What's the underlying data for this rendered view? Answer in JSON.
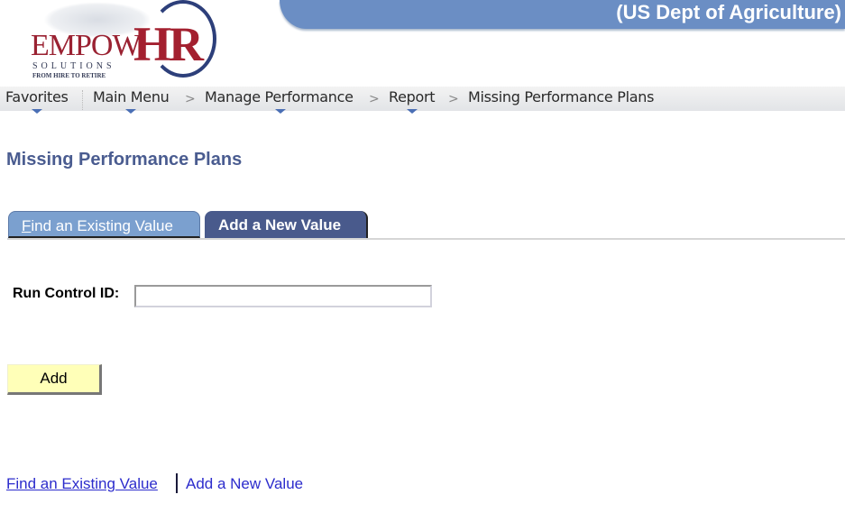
{
  "header": {
    "logo": {
      "brand_main": "EMPOW",
      "brand_accent": "HR",
      "subtitle": "SOLUTIONS",
      "tagline": "FROM HIRE TO RETIRE"
    },
    "organization": "(US Dept of Agriculture)"
  },
  "navbar": {
    "items": [
      {
        "label": "Favorites",
        "has_menu": true
      },
      {
        "label": "Main Menu",
        "has_menu": true
      },
      {
        "label": "Manage Performance",
        "has_menu": true
      },
      {
        "label": "Report",
        "has_menu": true
      },
      {
        "label": "Missing Performance Plans",
        "has_menu": false
      }
    ],
    "separator": ">"
  },
  "page": {
    "title": "Missing Performance Plans",
    "tabs": [
      {
        "label_first": "F",
        "label_rest": "ind an Existing Value",
        "active": false
      },
      {
        "label": "Add a New Value",
        "active": true
      }
    ],
    "form": {
      "run_control_label": "Run Control ID:",
      "run_control_value": "",
      "add_button_label": "Add"
    },
    "footer_links": [
      {
        "label": "Find an Existing Value",
        "active_link": true
      },
      {
        "label": "Add a New Value",
        "active_link": false
      }
    ]
  },
  "colors": {
    "banner": "#6b8ec4",
    "title": "#4a5c90",
    "tab_inactive": "#7ba0cf",
    "tab_active": "#495a8c",
    "button": "#ffffb8",
    "link": "#2c2ccc"
  }
}
